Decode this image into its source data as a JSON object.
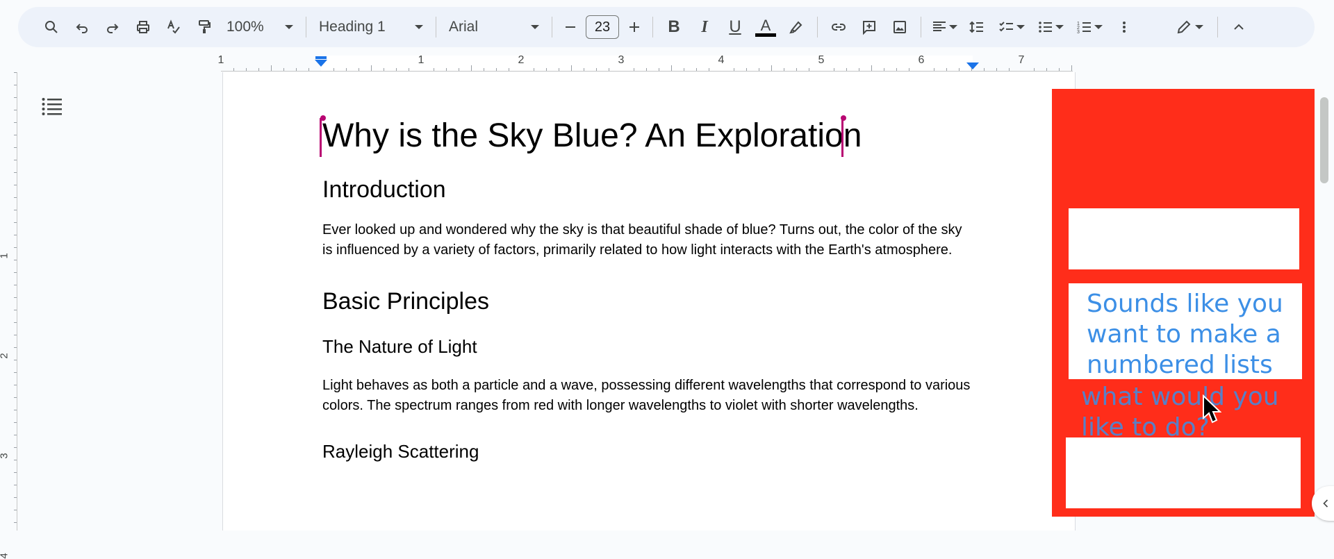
{
  "toolbar": {
    "zoom": "100%",
    "style": "Heading 1",
    "font": "Arial",
    "font_size": "23",
    "bold": "B",
    "italic": "I",
    "underline": "U",
    "text_color_letter": "A",
    "text_color_bar": "#000000"
  },
  "ruler": {
    "labels": [
      "1",
      "1",
      "2",
      "3",
      "4",
      "5",
      "6",
      "7"
    ],
    "left_labels": [
      "1",
      "2",
      "3",
      "4"
    ]
  },
  "document": {
    "title": "Why is the Sky Blue? An Exploration",
    "h_intro": "Introduction",
    "p_intro": "Ever looked up and wondered why the sky is that beautiful shade of blue? Turns out, the color of the sky is influenced by a variety of factors, primarily related to how light interacts with the Earth's atmosphere.",
    "h_basic": "Basic Principles",
    "h_light": "The Nature of Light",
    "p_light": "Light behaves as both a particle and a wave, possessing different wavelengths that correspond to various colors. The spectrum ranges from red with longer wavelengths to violet with shorter wavelengths.",
    "h_rayleigh": "Rayleigh Scattering"
  },
  "overlay": {
    "message_line1": "Sounds like you",
    "message_line2": "want to make a",
    "message_line3": "numbered lists",
    "message_line4": "what would you",
    "message_line5": "like to do?",
    "panel_color": "#ff2d1a",
    "text_color": "#3c8fe6"
  },
  "icons": [
    "search-icon",
    "undo-icon",
    "redo-icon",
    "print-icon",
    "spellcheck-icon",
    "paint-format-icon",
    "minus-icon",
    "plus-icon",
    "highlighter-icon",
    "link-icon",
    "add-comment-icon",
    "image-icon",
    "align-left-icon",
    "line-spacing-icon",
    "checklist-icon",
    "bulleted-list-icon",
    "numbered-list-icon",
    "more-vertical-icon",
    "editing-mode-pencil-icon",
    "collapse-chevron-up-icon",
    "outline-list-icon",
    "side-panel-chevron-left-icon"
  ]
}
